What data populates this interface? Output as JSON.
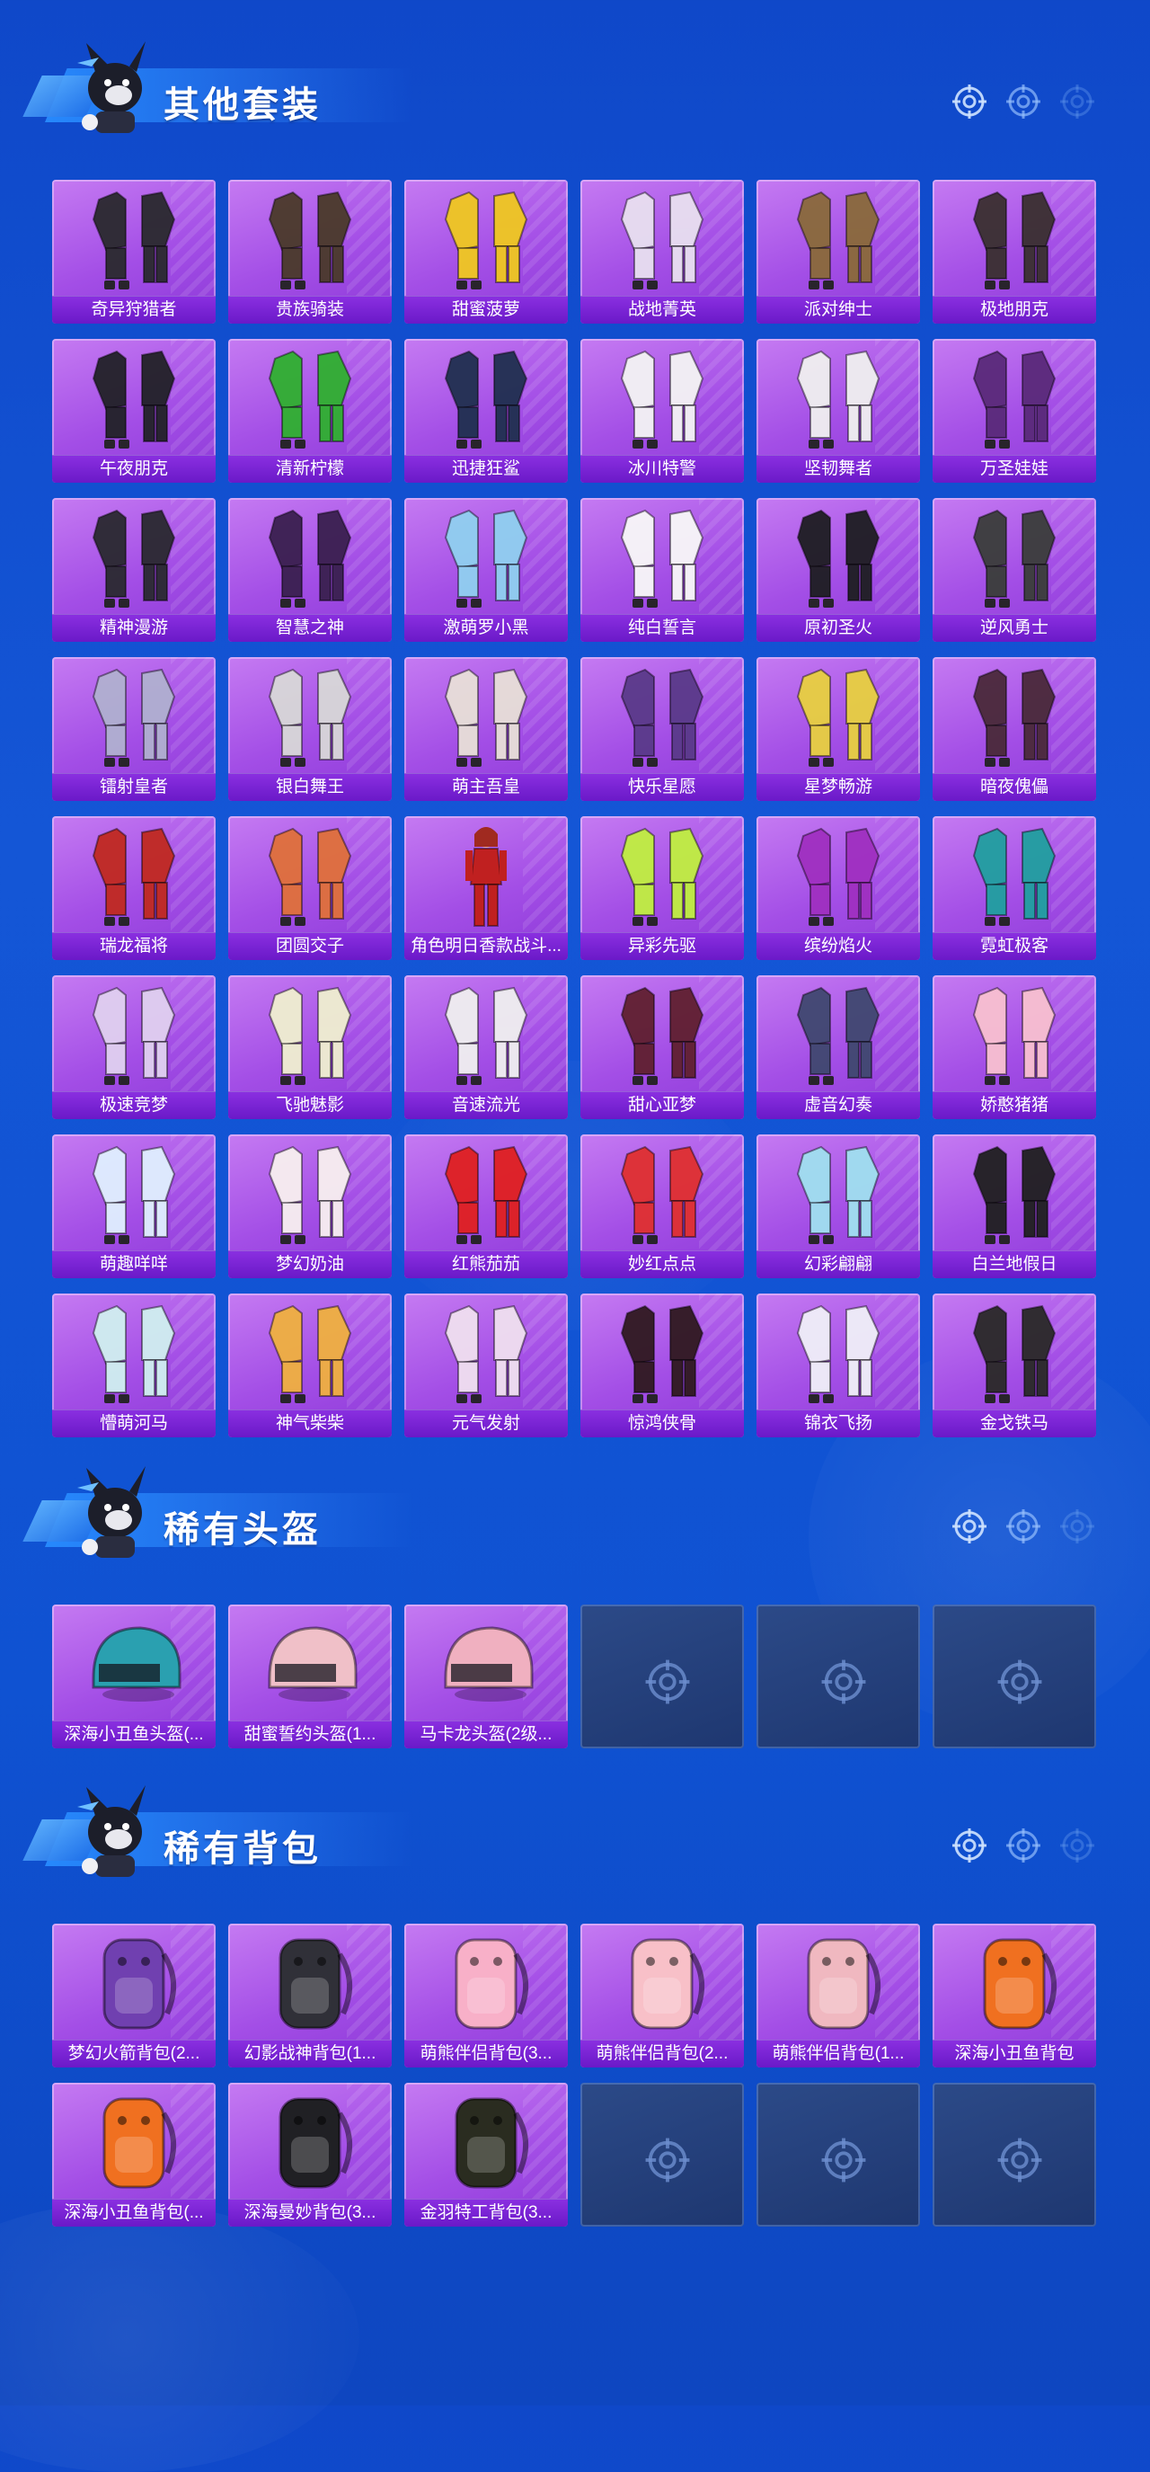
{
  "sections": [
    {
      "title": "其他套装",
      "items": [
        {
          "label": "奇异狩猎者",
          "icon": "outfit-icon",
          "color": "#2a2a2e"
        },
        {
          "label": "贵族骑装",
          "icon": "outfit-icon",
          "color": "#4a3a2a"
        },
        {
          "label": "甜蜜菠萝",
          "icon": "outfit-icon",
          "color": "#f0c820"
        },
        {
          "label": "战地菁英",
          "icon": "outfit-icon",
          "color": "#e8e0f0"
        },
        {
          "label": "派对绅士",
          "icon": "outfit-icon",
          "color": "#8a6a3a"
        },
        {
          "label": "极地朋克",
          "icon": "outfit-icon",
          "color": "#3a3030"
        },
        {
          "label": "午夜朋克",
          "icon": "outfit-icon",
          "color": "#222228"
        },
        {
          "label": "清新柠檬",
          "icon": "outfit-icon",
          "color": "#30b030"
        },
        {
          "label": "迅捷狂鲨",
          "icon": "outfit-icon",
          "color": "#203050"
        },
        {
          "label": "冰川特警",
          "icon": "outfit-icon",
          "color": "#f4f4f4"
        },
        {
          "label": "坚韧舞者",
          "icon": "outfit-icon",
          "color": "#f0f0f0"
        },
        {
          "label": "万圣娃娃",
          "icon": "outfit-icon",
          "color": "#5a2a7a"
        },
        {
          "label": "精神漫游",
          "icon": "outfit-icon",
          "color": "#2a2a30"
        },
        {
          "label": "智慧之神",
          "icon": "outfit-icon",
          "color": "#3a2050"
        },
        {
          "label": "激萌罗小黑",
          "icon": "outfit-icon",
          "color": "#90d0f0"
        },
        {
          "label": "纯白誓言",
          "icon": "outfit-icon",
          "color": "#f8f8f8"
        },
        {
          "label": "原初圣火",
          "icon": "outfit-icon",
          "color": "#1e1e22"
        },
        {
          "label": "逆风勇士",
          "icon": "outfit-icon",
          "color": "#3a3e3a"
        },
        {
          "label": "镭射皇者",
          "icon": "outfit-icon",
          "color": "#b0b0d0"
        },
        {
          "label": "银白舞王",
          "icon": "outfit-icon",
          "color": "#d8d8d8"
        },
        {
          "label": "萌主吾皇",
          "icon": "outfit-icon",
          "color": "#e8e0d8"
        },
        {
          "label": "快乐星愿",
          "icon": "outfit-icon",
          "color": "#5a3a8a"
        },
        {
          "label": "星梦畅游",
          "icon": "outfit-icon",
          "color": "#e8d040"
        },
        {
          "label": "暗夜傀儡",
          "icon": "outfit-icon",
          "color": "#4a2a3a"
        },
        {
          "label": "瑞龙福将",
          "icon": "outfit-icon",
          "color": "#c02a20"
        },
        {
          "label": "团圆交子",
          "icon": "outfit-icon",
          "color": "#e0703a"
        },
        {
          "label": "角色明日香款战斗...",
          "icon": "character-icon",
          "color": "#c02020"
        },
        {
          "label": "异彩先驱",
          "icon": "outfit-icon",
          "color": "#c0f040"
        },
        {
          "label": "缤纷焰火",
          "icon": "outfit-icon",
          "color": "#a030c0"
        },
        {
          "label": "霓虹极客",
          "icon": "outfit-icon",
          "color": "#20a0a0"
        },
        {
          "label": "极速竞梦",
          "icon": "outfit-icon",
          "color": "#e0d0f0"
        },
        {
          "label": "飞驰魅影",
          "icon": "outfit-icon",
          "color": "#f0f0d0"
        },
        {
          "label": "音速流光",
          "icon": "outfit-icon",
          "color": "#f0f0f0"
        },
        {
          "label": "甜心亚梦",
          "icon": "outfit-icon",
          "color": "#602030"
        },
        {
          "label": "虚音幻奏",
          "icon": "outfit-icon",
          "color": "#404870"
        },
        {
          "label": "娇憨猪猪",
          "icon": "outfit-icon",
          "color": "#f8c0d0"
        },
        {
          "label": "萌趣咩咩",
          "icon": "outfit-icon",
          "color": "#e0f0ff"
        },
        {
          "label": "梦幻奶油",
          "icon": "outfit-icon",
          "color": "#f8f0f0"
        },
        {
          "label": "红熊茄茄",
          "icon": "outfit-icon",
          "color": "#e02020"
        },
        {
          "label": "妙红点点",
          "icon": "outfit-icon",
          "color": "#e03030"
        },
        {
          "label": "幻彩翩翩",
          "icon": "outfit-icon",
          "color": "#a0e0f0"
        },
        {
          "label": "白兰地假日",
          "icon": "outfit-icon",
          "color": "#202020"
        },
        {
          "label": "懵萌河马",
          "icon": "outfit-icon",
          "color": "#d0f0f0"
        },
        {
          "label": "神气柴柴",
          "icon": "outfit-icon",
          "color": "#f0b040"
        },
        {
          "label": "元气发射",
          "icon": "outfit-icon",
          "color": "#f0e0f0"
        },
        {
          "label": "惊鸿侠骨",
          "icon": "outfit-icon",
          "color": "#301a20"
        },
        {
          "label": "锦衣飞扬",
          "icon": "outfit-icon",
          "color": "#f0f0f8"
        },
        {
          "label": "金戈铁马",
          "icon": "outfit-icon",
          "color": "#2a2a28"
        }
      ],
      "empty_slots": 0
    },
    {
      "title": "稀有头盔",
      "items": [
        {
          "label": "深海小丑鱼头盔(...",
          "icon": "helmet-icon",
          "color": "#2aa0b0"
        },
        {
          "label": "甜蜜誓约头盔(1...",
          "icon": "helmet-icon",
          "color": "#f0c0c8"
        },
        {
          "label": "马卡龙头盔(2级...",
          "icon": "helmet-icon",
          "color": "#f0b0c0"
        }
      ],
      "empty_slots": 3
    },
    {
      "title": "稀有背包",
      "items": [
        {
          "label": "梦幻火箭背包(2...",
          "icon": "backpack-icon",
          "color": "#7040b0"
        },
        {
          "label": "幻影战神背包(1...",
          "icon": "backpack-icon",
          "color": "#303038"
        },
        {
          "label": "萌熊伴侣背包(3...",
          "icon": "backpack-icon",
          "color": "#f8b0c8"
        },
        {
          "label": "萌熊伴侣背包(2...",
          "icon": "backpack-icon",
          "color": "#f8c0c8"
        },
        {
          "label": "萌熊伴侣背包(1...",
          "icon": "backpack-icon",
          "color": "#f0b8c0"
        },
        {
          "label": "深海小丑鱼背包",
          "icon": "backpack-icon",
          "color": "#f07020"
        },
        {
          "label": "深海小丑鱼背包(...",
          "icon": "backpack-icon",
          "color": "#f07020"
        },
        {
          "label": "深海曼妙背包(3...",
          "icon": "backpack-icon",
          "color": "#202024"
        },
        {
          "label": "金羽特工背包(3...",
          "icon": "backpack-icon",
          "color": "#2a2c20"
        }
      ],
      "empty_slots": 3
    }
  ]
}
